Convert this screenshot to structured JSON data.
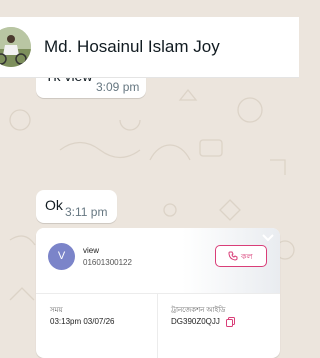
{
  "header": {
    "contact_name": "Md. Hosainul Islam Joy"
  },
  "messages": [
    {
      "text": "Tk view",
      "time": "3:09 pm"
    },
    {
      "text": "Ok",
      "time": "3:11 pm"
    }
  ],
  "contact_card": {
    "avatar_letter": "V",
    "name": "view",
    "phone": "01601300122",
    "call_label": "কল",
    "time_label": "সময়",
    "time_value": "03:13pm 03/07/26",
    "txn_label": "ট্রানজেকশন আইডি",
    "txn_value": "DG390Z0QJJ"
  },
  "colors": {
    "accent": "#d93e78",
    "avatar": "#7b84c9",
    "wallpaper": "#ece5dd"
  },
  "icons": [
    "phone-icon",
    "copy-icon",
    "chevron-down-icon"
  ]
}
